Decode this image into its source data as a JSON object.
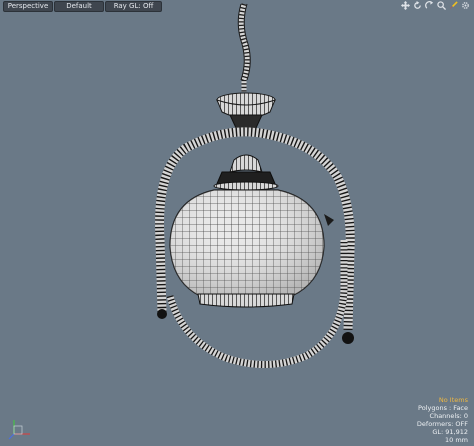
{
  "viewport": {
    "view_label": "Perspective",
    "style_label": "Default",
    "raygl_label": "Ray GL: Off"
  },
  "nav_icons": [
    "move-view-icon",
    "rotate-view-icon",
    "zoom-view-icon",
    "search-icon",
    "brush-icon",
    "settings-icon"
  ],
  "scene": {
    "object": "hanging lamp wireframe model"
  },
  "info": {
    "selection": "No Items",
    "polygons": "Polygons : Face",
    "channels": "Channels: 0",
    "deformers": "Deformers: OFF",
    "gl": "GL: 91,912",
    "units": "10 mm"
  },
  "colors": {
    "background": "#6a7987",
    "selection_warning": "#f0b840"
  }
}
